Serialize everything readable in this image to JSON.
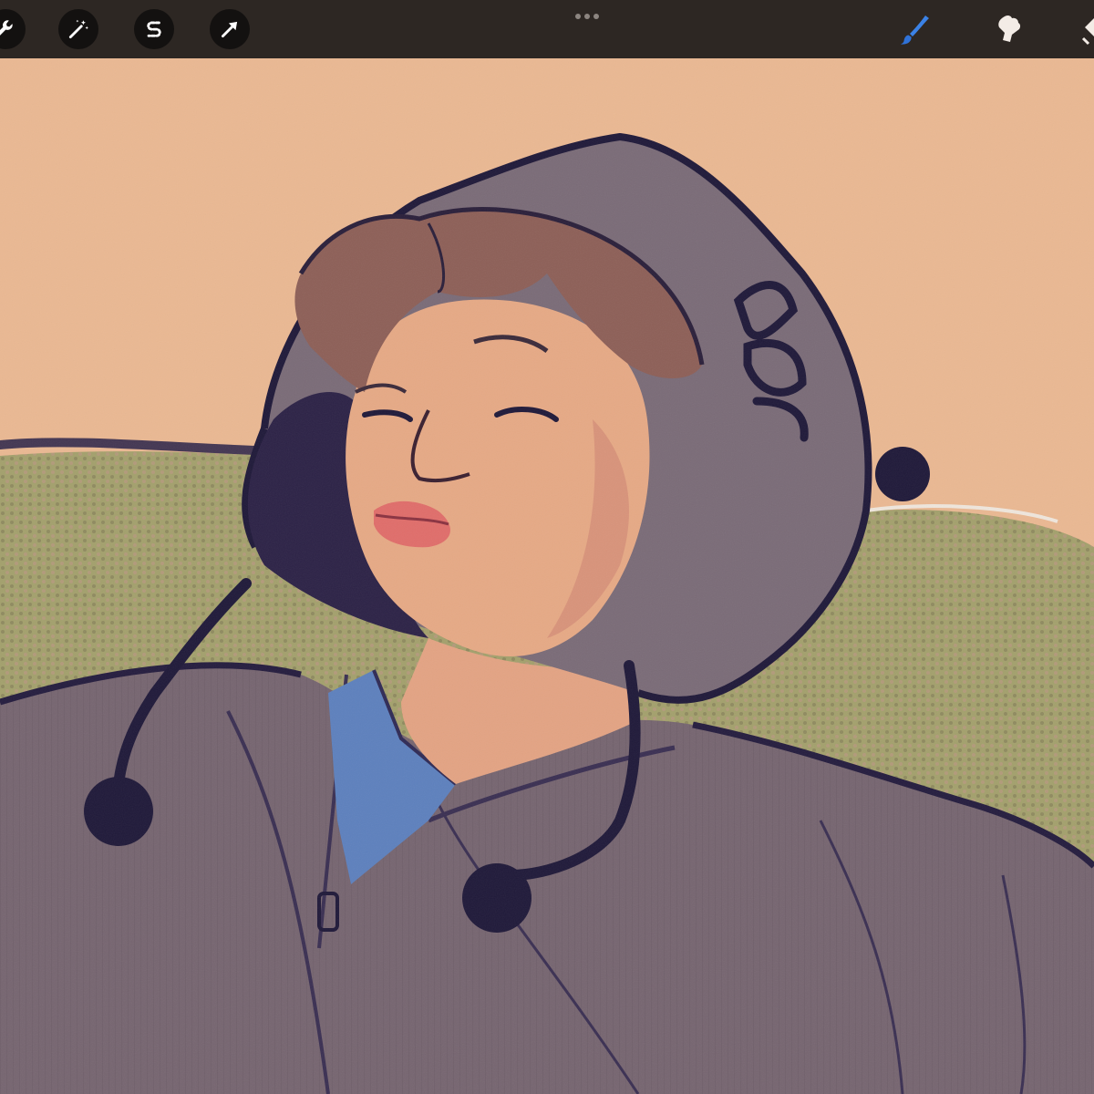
{
  "toolbar": {
    "left_tools": [
      {
        "name": "actions",
        "icon": "wrench-icon"
      },
      {
        "name": "adjustments",
        "icon": "magic-wand-icon"
      },
      {
        "name": "selection",
        "icon": "selection-s-icon"
      },
      {
        "name": "transform",
        "icon": "arrow-cursor-icon"
      }
    ],
    "center": {
      "icon": "more-dots-icon"
    },
    "right_tools": [
      {
        "name": "paint",
        "icon": "brush-icon",
        "active": true,
        "color": "#2f72d8"
      },
      {
        "name": "smudge",
        "icon": "smudge-icon",
        "active": false
      },
      {
        "name": "erase",
        "icon": "eraser-icon",
        "active": false
      }
    ]
  },
  "canvas": {
    "artwork": "digital-portrait-illustration"
  },
  "colors": {
    "toolbar_bg": "#2d2723",
    "button_bg": "#131110",
    "accent_blue": "#2f72d8",
    "background_peach": "#eab892",
    "couch_green": "#9c9a66",
    "hoodie_gray": "#74656f",
    "skin": "#e6a985",
    "hair_brown": "#8d5f57",
    "shirt_blue": "#5d80bd",
    "ink": "#1f1939"
  }
}
